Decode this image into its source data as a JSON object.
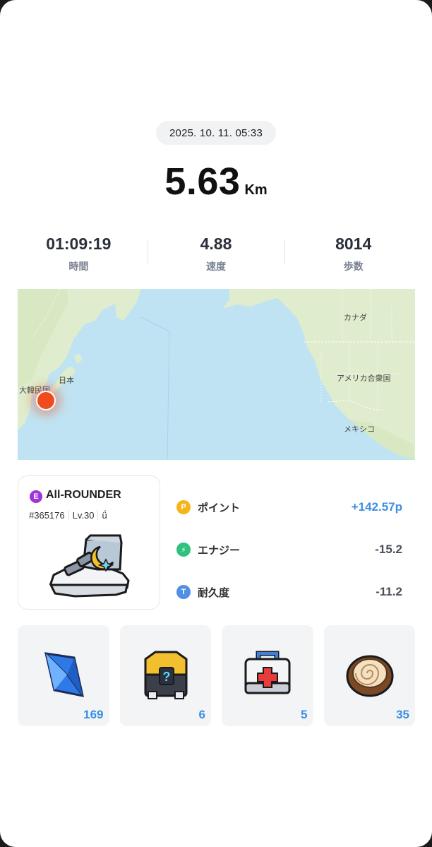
{
  "header": {
    "datetime": "2025. 10. 11. 05:33"
  },
  "distance": {
    "value": "5.63",
    "unit": "Km"
  },
  "stats": [
    {
      "value": "01:09:19",
      "label": "時間"
    },
    {
      "value": "4.88",
      "label": "速度"
    },
    {
      "value": "8014",
      "label": "歩数"
    }
  ],
  "map": {
    "labels": {
      "korea": "大韓民国",
      "japan": "日本",
      "canada": "カナダ",
      "usa": "アメリカ合衆国",
      "mexico": "メキシコ"
    },
    "marker_color": "#f04b1f"
  },
  "shoe": {
    "grade": "E",
    "name": "All-ROUNDER",
    "id": "#365176",
    "level": "Lv.30",
    "badge": "ǘ"
  },
  "rewards": [
    {
      "icon": "P",
      "icon_color": "#f5b41a",
      "label": "ポイント",
      "value": "+142.57p"
    },
    {
      "icon": "⚡",
      "icon_color": "#2fc27d",
      "label": "エナジー",
      "value": "-15.2"
    },
    {
      "icon": "T",
      "icon_color": "#4f8fe6",
      "label": "耐久度",
      "value": "-11.2"
    }
  ],
  "items": [
    {
      "icon": "gem-icon",
      "count": "169"
    },
    {
      "icon": "mystery-box-icon",
      "count": "6"
    },
    {
      "icon": "first-aid-kit-icon",
      "count": "5"
    },
    {
      "icon": "ammonite-fossil-icon",
      "count": "35"
    }
  ]
}
